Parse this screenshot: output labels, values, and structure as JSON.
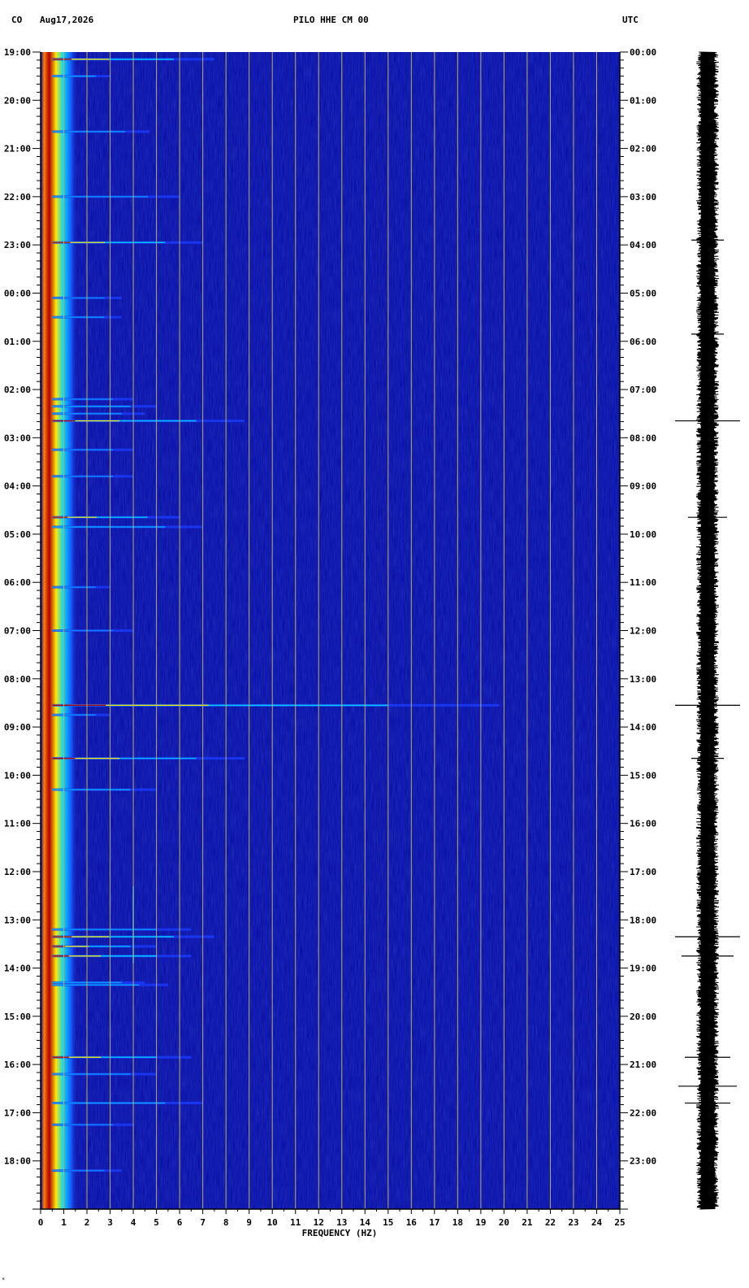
{
  "header": {
    "network": "CO",
    "date": "Aug17,2026",
    "station": "PILO HHE CM 00",
    "timezone": "UTC"
  },
  "footer_mark": "*",
  "chart_data": {
    "type": "heatmap",
    "xlabel": "FREQUENCY (HZ)",
    "xlim": [
      0,
      25
    ],
    "x_ticks": [
      0,
      1,
      2,
      3,
      4,
      5,
      6,
      7,
      8,
      9,
      10,
      11,
      12,
      13,
      14,
      15,
      16,
      17,
      18,
      19,
      20,
      21,
      22,
      23,
      24,
      25
    ],
    "ylim_hours": [
      0,
      24
    ],
    "left_ticks": [
      "19:00",
      "20:00",
      "21:00",
      "22:00",
      "23:00",
      "00:00",
      "01:00",
      "02:00",
      "03:00",
      "04:00",
      "05:00",
      "06:00",
      "07:00",
      "08:00",
      "09:00",
      "10:00",
      "11:00",
      "12:00",
      "13:00",
      "14:00",
      "15:00",
      "16:00",
      "17:00",
      "18:00"
    ],
    "right_ticks": [
      "00:00",
      "01:00",
      "02:00",
      "03:00",
      "04:00",
      "05:00",
      "06:00",
      "07:00",
      "08:00",
      "09:00",
      "10:00",
      "11:00",
      "12:00",
      "13:00",
      "14:00",
      "15:00",
      "16:00",
      "17:00",
      "18:00",
      "19:00",
      "20:00",
      "21:00",
      "22:00",
      "23:00"
    ],
    "colors": {
      "background": "#0a0fa6",
      "low": "#1a3cff",
      "mid": "#00c8ff",
      "high": "#ffe800",
      "peak": "#b00000",
      "grid": "#b8ad5e"
    },
    "low_freq_band": {
      "freq_range": [
        0.3,
        1.0
      ]
    },
    "events": [
      {
        "t": 0.15,
        "fmax": 7.5,
        "level": 0.9
      },
      {
        "t": 0.5,
        "fmax": 3.0,
        "level": 0.7
      },
      {
        "t": 1.65,
        "fmax": 4.7,
        "level": 0.6
      },
      {
        "t": 3.0,
        "fmax": 6.0,
        "level": 0.6
      },
      {
        "t": 3.95,
        "fmax": 7.0,
        "level": 0.9
      },
      {
        "t": 5.1,
        "fmax": 3.5,
        "level": 0.5
      },
      {
        "t": 5.5,
        "fmax": 3.5,
        "level": 0.6
      },
      {
        "t": 7.2,
        "fmax": 4.0,
        "level": 0.5
      },
      {
        "t": 7.35,
        "fmax": 5.0,
        "level": 0.7
      },
      {
        "t": 7.5,
        "fmax": 4.5,
        "level": 0.6
      },
      {
        "t": 7.65,
        "fmax": 8.8,
        "level": 0.9
      },
      {
        "t": 8.25,
        "fmax": 4.0,
        "level": 0.5
      },
      {
        "t": 8.8,
        "fmax": 4.0,
        "level": 0.5
      },
      {
        "t": 9.65,
        "fmax": 6.0,
        "level": 0.85
      },
      {
        "t": 9.85,
        "fmax": 7.0,
        "level": 0.7
      },
      {
        "t": 11.1,
        "fmax": 3.0,
        "level": 0.5
      },
      {
        "t": 12.0,
        "fmax": 4.0,
        "level": 0.5
      },
      {
        "t": 13.55,
        "fmax": 19.8,
        "level": 1.0
      },
      {
        "t": 13.75,
        "fmax": 3.0,
        "level": 0.6
      },
      {
        "t": 14.65,
        "fmax": 8.8,
        "level": 0.85
      },
      {
        "t": 15.3,
        "fmax": 5.0,
        "level": 0.7
      },
      {
        "t": 18.2,
        "fmax": 6.5,
        "level": 0.6
      },
      {
        "t": 18.35,
        "fmax": 7.5,
        "level": 1.0
      },
      {
        "t": 18.55,
        "fmax": 5.0,
        "level": 0.8
      },
      {
        "t": 18.75,
        "fmax": 6.5,
        "level": 1.0
      },
      {
        "t": 19.3,
        "fmax": 4.5,
        "level": 0.7
      },
      {
        "t": 19.35,
        "fmax": 5.5,
        "level": 0.7
      },
      {
        "t": 20.85,
        "fmax": 6.5,
        "level": 0.85
      },
      {
        "t": 21.2,
        "fmax": 5.0,
        "level": 0.6
      },
      {
        "t": 21.8,
        "fmax": 7.0,
        "level": 0.7
      },
      {
        "t": 22.25,
        "fmax": 4.0,
        "level": 0.5
      },
      {
        "t": 23.2,
        "fmax": 3.5,
        "level": 0.5
      }
    ],
    "vertical_feature": {
      "freq": 4.0,
      "t_range": [
        17.3,
        18.9
      ]
    },
    "waveform_spikes": [
      {
        "t": 3.9,
        "amp": 0.5
      },
      {
        "t": 5.85,
        "amp": 0.5
      },
      {
        "t": 7.65,
        "amp": 1.0
      },
      {
        "t": 9.65,
        "amp": 0.6
      },
      {
        "t": 13.55,
        "amp": 1.0
      },
      {
        "t": 14.65,
        "amp": 0.5
      },
      {
        "t": 18.35,
        "amp": 1.0
      },
      {
        "t": 18.75,
        "amp": 0.8
      },
      {
        "t": 20.85,
        "amp": 0.7
      },
      {
        "t": 21.45,
        "amp": 0.9
      },
      {
        "t": 21.8,
        "amp": 0.7
      }
    ]
  }
}
